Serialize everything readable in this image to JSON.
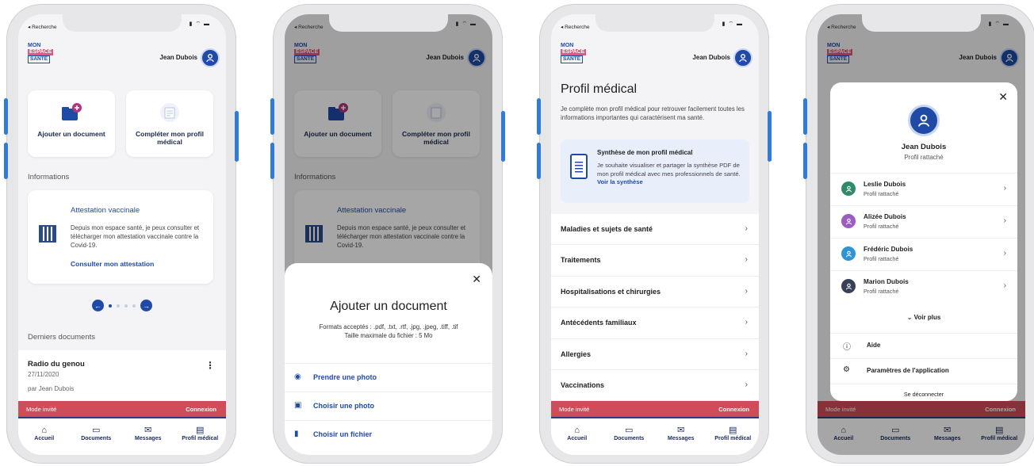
{
  "status": {
    "back_label": "◂ Recherche",
    "signal": "▮ ⌔ ▬"
  },
  "header": {
    "logo_line1": "MON",
    "logo_line2": "ESPACE",
    "logo_line3": "SANTÉ",
    "user_name": "Jean Dubois"
  },
  "home": {
    "quick_add_label": "Ajouter un document",
    "quick_profile_label": "Compléter mon profil médical",
    "info_section": "Informations",
    "info_card": {
      "title": "Attestation vaccinale",
      "text": "Depuis mon espace santé, je peux consulter et télécharger mon attestation vaccinale contre la Covid-19.",
      "link": "Consulter mon attestation"
    },
    "docs_section": "Derniers documents",
    "doc": {
      "name": "Radio du genou",
      "date": "27/11/2020",
      "by": "par Jean Dubois"
    }
  },
  "guest_bar": {
    "mode": "Mode invité",
    "connect": "Connexion"
  },
  "tabs": [
    {
      "label": "Accueil",
      "icon": "⌂"
    },
    {
      "label": "Documents",
      "icon": "▭"
    },
    {
      "label": "Messages",
      "icon": "✉"
    },
    {
      "label": "Profil médical",
      "icon": "▤"
    }
  ],
  "add_sheet": {
    "title": "Ajouter un document",
    "formats": "Formats acceptés : .pdf, .txt, .rtf, .jpg, .jpeg, .tiff, .tif",
    "max_size": "Taille maximale du fichier : 5 Mo",
    "options": [
      {
        "label": "Prendre une photo",
        "icon": "◉"
      },
      {
        "label": "Choisir une photo",
        "icon": "▣"
      },
      {
        "label": "Choisir un fichier",
        "icon": "▮"
      }
    ]
  },
  "profil": {
    "title": "Profil médical",
    "desc": "Je complète mon profil médical pour retrouver facilement toutes les informations importantes qui caractérisent ma santé.",
    "synth_title": "Synthèse de mon profil médical",
    "synth_text": "Je souhaite visualiser et partager la synthèse PDF de mon profil médical avec mes professionnels de santé.",
    "synth_link": "Voir la synthèse",
    "items": [
      "Maladies et sujets de santé",
      "Traitements",
      "Hospitalisations et chirurgies",
      "Antécédents familiaux",
      "Allergies",
      "Vaccinations"
    ]
  },
  "switcher": {
    "name": "Jean Dubois",
    "role": "Profil rattaché",
    "profiles": [
      {
        "name": "Leslie Dubois",
        "role": "Profil rattaché",
        "color": "#2f8a6a"
      },
      {
        "name": "Alizée Dubois",
        "role": "Profil rattaché",
        "color": "#9c5cc0"
      },
      {
        "name": "Frédéric Dubois",
        "role": "Profil rattaché",
        "color": "#2f93d6"
      },
      {
        "name": "Marion Dubois",
        "role": "Profil rattaché",
        "color": "#3a3f58"
      }
    ],
    "more": "Voir plus",
    "help": "Aide",
    "settings": "Paramètres de l'application",
    "logout": "Se déconnecter"
  }
}
